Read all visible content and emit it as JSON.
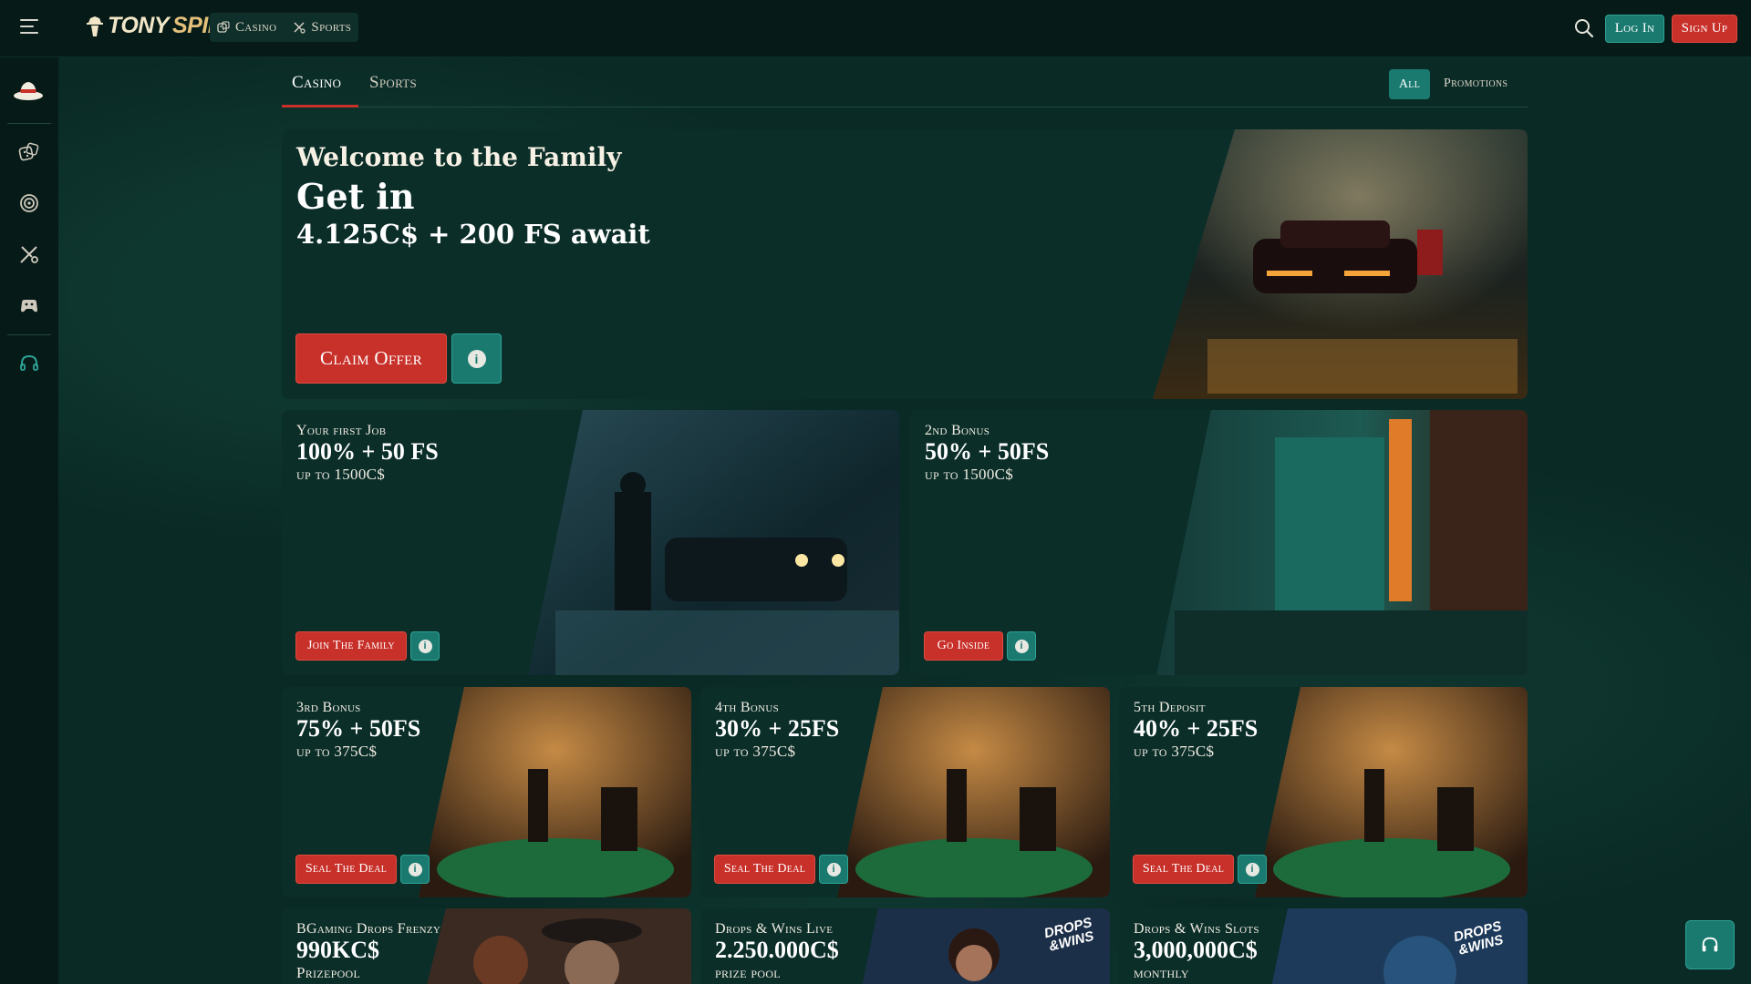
{
  "header": {
    "logo_left": "TONY",
    "logo_right": "SPINS",
    "nav": [
      {
        "label": "Casino",
        "icon": "dice-icon"
      },
      {
        "label": "Sports",
        "icon": "sports-icon"
      }
    ],
    "login_label": "Log In",
    "signup_label": "Sign Up"
  },
  "sidebar": {
    "icons": [
      "hat-icon",
      "dice-icon",
      "target-icon",
      "sports-icon",
      "gamepad-icon",
      "headset-icon"
    ]
  },
  "tabs": {
    "items": [
      "Casino",
      "Sports"
    ],
    "active": "Casino",
    "filters": [
      "All",
      "Promotions"
    ],
    "active_filter": "All"
  },
  "hero": {
    "line1": "Welcome to the Family",
    "line2": "Get in",
    "line3": "4.125C$ + 200 FS await",
    "cta": "Claim Offer",
    "info": "i"
  },
  "row2": [
    {
      "kicker": "Your first Job",
      "headline": "100% + 50 FS",
      "sub": "up to 1500C$",
      "cta": "Join The Family"
    },
    {
      "kicker": "2nd Bonus",
      "headline": "50% + 50FS",
      "sub": "up to 1500C$",
      "cta": "Go Inside"
    }
  ],
  "row3": [
    {
      "kicker": "3rd Bonus",
      "headline": "75% + 50FS",
      "sub": "up to 375C$",
      "cta": "Seal The Deal"
    },
    {
      "kicker": "4th Bonus",
      "headline": "30% + 25FS",
      "sub": "up to 375C$",
      "cta": "Seal The Deal"
    },
    {
      "kicker": "5th Deposit",
      "headline": "40% + 25FS",
      "sub": "up to 375C$",
      "cta": "Seal The Deal"
    }
  ],
  "row4": [
    {
      "kicker": "BGaming Drops Frenzy",
      "headline": "990KC$",
      "sub": "Prizepool"
    },
    {
      "kicker": "Drops & Wins Live",
      "headline": "2.250.000C$",
      "sub": "prize pool"
    },
    {
      "kicker": "Drops & Wins Slots",
      "headline": "3,000,000C$",
      "sub": "monthly"
    }
  ],
  "drops_wins_badge": "DROPS &WINS",
  "colors": {
    "background": "#0a2a25",
    "topbar": "#061a17",
    "card": "#0b2e29",
    "accent_red": "#c8302a",
    "accent_teal": "#1a7a70",
    "logo_gold": "#e3c07a"
  }
}
